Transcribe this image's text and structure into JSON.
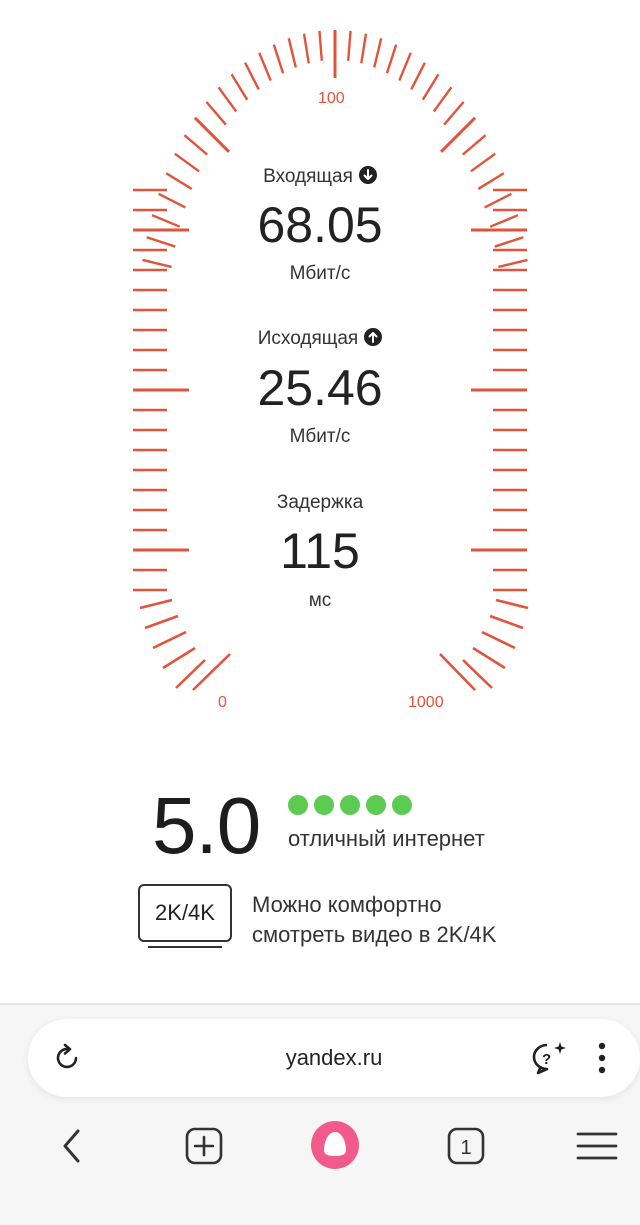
{
  "speed_test": {
    "download": {
      "label": "Входящая",
      "value": "68.05",
      "unit": "Мбит/с",
      "icon": "arrow-down-icon"
    },
    "upload": {
      "label": "Исходящая",
      "value": "25.46",
      "unit": "Мбит/с",
      "icon": "arrow-up-icon"
    },
    "latency": {
      "label": "Задержка",
      "value": "115",
      "unit": "мс"
    },
    "scale": {
      "min_label": "0",
      "mid_label": "100",
      "max_label": "1000"
    }
  },
  "rating": {
    "score": "5.0",
    "stars": 5,
    "max_stars": 5,
    "summary": "отличный интернет",
    "quality_badge": "2K/4K",
    "quality_line1": "Можно комфортно",
    "quality_line2": "смотреть видео в 2K/4K"
  },
  "browser": {
    "url": "yandex.ru",
    "tab_count": "1",
    "icons": {
      "reload": "reload-icon",
      "help": "help-chat-icon",
      "more": "more-vertical-icon",
      "back": "back-icon",
      "new_tab": "new-tab-icon",
      "alice": "alice-icon",
      "tabs": "tabs-icon",
      "menu": "menu-icon"
    }
  },
  "colors": {
    "gauge": "#e2543a",
    "stars": "#5ccb52",
    "alice": "#f25a8b"
  }
}
